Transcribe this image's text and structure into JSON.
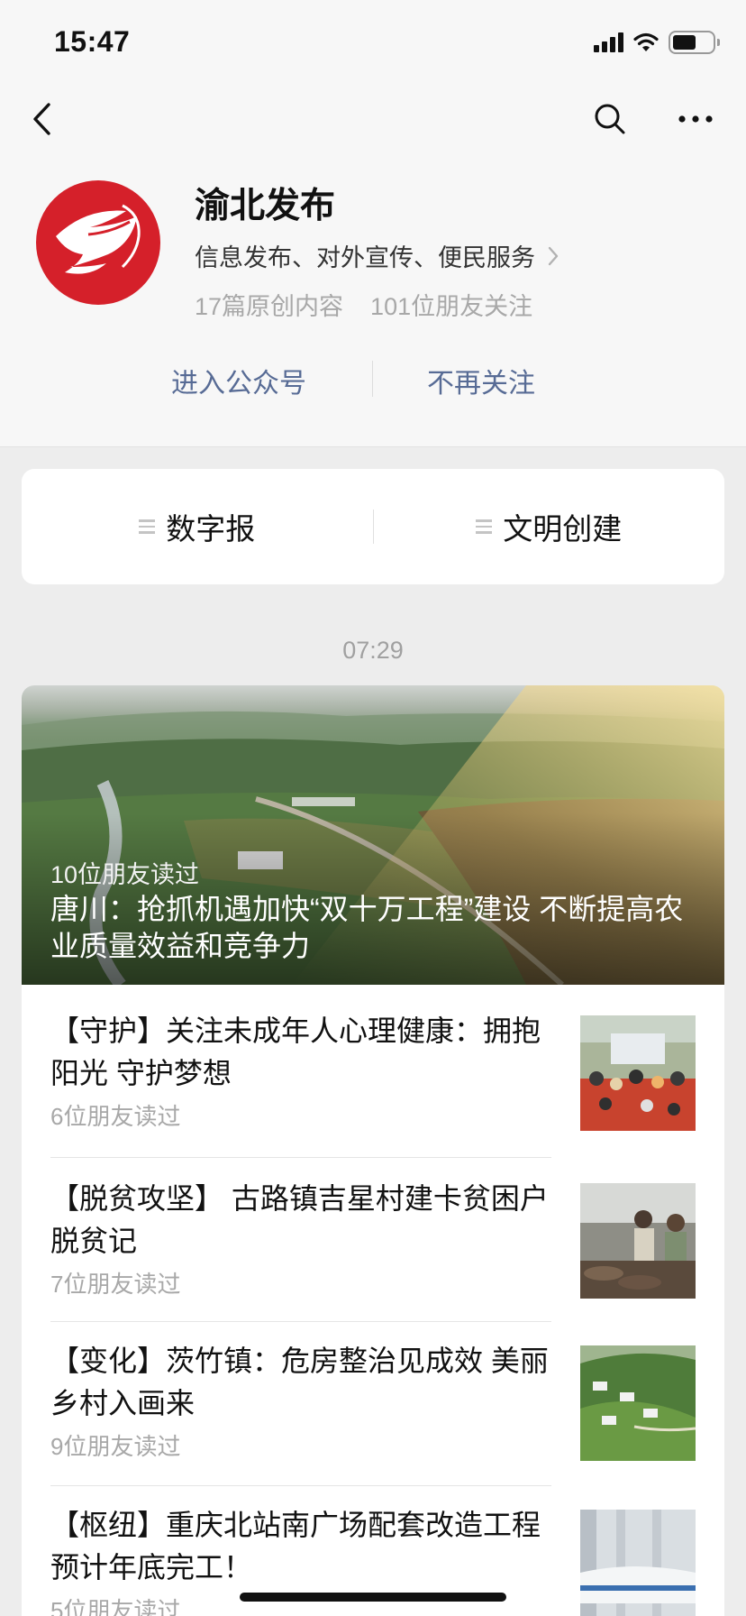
{
  "status_bar": {
    "time": "15:47",
    "signal_icon": "signal-icon",
    "wifi_icon": "wifi-icon",
    "battery_icon": "battery-icon",
    "battery_level": 0.6
  },
  "nav": {
    "back_icon": "chevron-left-icon",
    "search_icon": "search-icon",
    "more_icon": "more-dots-icon"
  },
  "account": {
    "name": "渝北发布",
    "description": "信息发布、对外宣传、便民服务",
    "original_count": "17篇原创内容",
    "friends_follow": "101位朋友关注",
    "brand_color": "#d5202a"
  },
  "actions": {
    "enter": "进入公众号",
    "unfollow": "不再关注",
    "link_color": "#576b95"
  },
  "menu": {
    "items": [
      {
        "label": "数字报"
      },
      {
        "label": "文明创建"
      }
    ]
  },
  "timestamp": "07:29",
  "hero": {
    "readers": "10位朋友读过",
    "title": "唐川：抢抓机遇加快“双十万工程”建设 不断提高农业质量效益和竞争力"
  },
  "articles": [
    {
      "title": "【守护】关注未成年人心理健康：拥抱阳光  守护梦想",
      "readers": "6位朋友读过"
    },
    {
      "title": "【脱贫攻坚】 古路镇吉星村建卡贫困户脱贫记",
      "readers": "7位朋友读过"
    },
    {
      "title": "【变化】茨竹镇：危房整治见成效 美丽乡村入画来",
      "readers": "9位朋友读过"
    },
    {
      "title": "【枢纽】重庆北站南广场配套改造工程预计年底完工！",
      "readers": "5位朋友读过"
    }
  ]
}
